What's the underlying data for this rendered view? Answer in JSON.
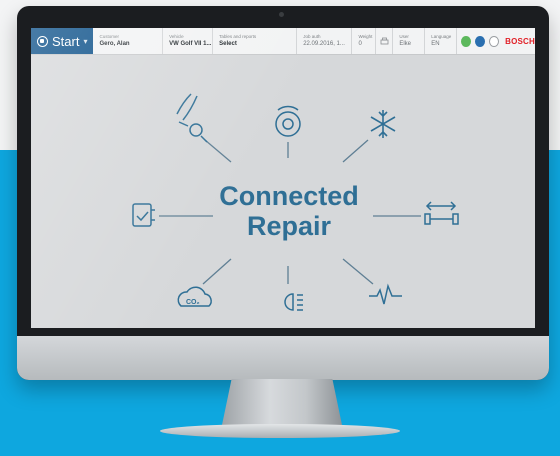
{
  "topbar": {
    "start_label": "Start",
    "customer": {
      "label": "Customer",
      "value": "Gero, Alan"
    },
    "vehicle": {
      "label": "Vehicle",
      "value": "VW Golf VII 1..."
    },
    "tables": {
      "label": "Tables and reports",
      "value": "Select"
    },
    "date": {
      "label": "Job auth",
      "value": "22.09.2016, 1..."
    },
    "weight": {
      "label": "Weight",
      "value": "0"
    },
    "user": {
      "label": "User",
      "value": "Elke"
    },
    "language": {
      "label": "Language",
      "value": "EN"
    },
    "brand": "BOSCH"
  },
  "diagram": {
    "title_line1": "Connected",
    "title_line2": "Repair",
    "icons": [
      "wheel-alignment-icon",
      "brake-disc-icon",
      "air-conditioning-icon",
      "diagnostic-checklist-icon",
      "axle-measurement-icon",
      "co2-emissions-icon",
      "headlight-icon",
      "heartbeat-icon"
    ]
  },
  "colors": {
    "brand_blue": "#0ea7df",
    "start_blue": "#0a4f88",
    "diagram_blue": "#2f6f95",
    "bosch_red": "#e11f26",
    "status_green": "#5cb85c",
    "status_blue": "#2a6fb0"
  }
}
